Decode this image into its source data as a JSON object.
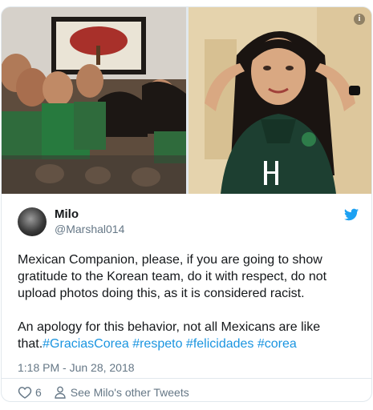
{
  "tweet": {
    "author_name": "Milo",
    "author_handle": "@Marshal014",
    "text_part1": "Mexican Companion, please, if you are going to show gratitude to the Korean team, do it with respect, do not upload photos doing this, as it is considered racist.\n\nAn apology for this behavior, not all Mexicans are like that.",
    "hashtags": [
      "#GraciasCorea",
      "#respeto",
      "#felicidades",
      "#corea"
    ],
    "timestamp": "1:18 PM - Jun 28, 2018",
    "like_count": "6",
    "more_link": "See Milo's other Tweets"
  },
  "media": {
    "info_glyph": "i"
  },
  "colors": {
    "link": "#1b95e0",
    "muted": "#657786",
    "border": "#e1e8ed",
    "text": "#14171a"
  },
  "icons": [
    "info-icon",
    "twitter-bird-icon",
    "heart-icon",
    "person-icon"
  ]
}
